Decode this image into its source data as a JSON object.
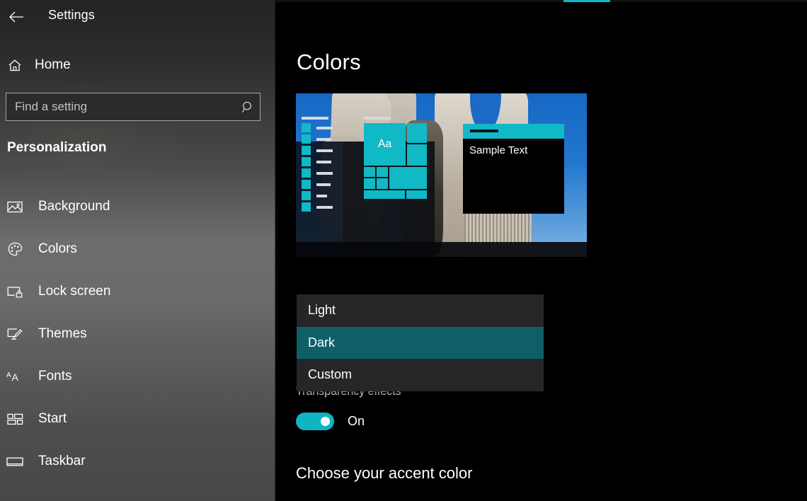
{
  "window": {
    "back_icon": "back-arrow-icon",
    "title": "Settings"
  },
  "sidebar": {
    "home": {
      "label": "Home",
      "icon": "home-icon"
    },
    "search": {
      "placeholder": "Find a setting",
      "value": "",
      "icon": "search-icon"
    },
    "section_title": "Personalization",
    "items": [
      {
        "label": "Background",
        "icon": "picture-icon"
      },
      {
        "label": "Colors",
        "icon": "palette-icon"
      },
      {
        "label": "Lock screen",
        "icon": "lock-screen-icon"
      },
      {
        "label": "Themes",
        "icon": "themes-brush-icon"
      },
      {
        "label": "Fonts",
        "icon": "fonts-icon"
      },
      {
        "label": "Start",
        "icon": "start-tiles-icon"
      },
      {
        "label": "Taskbar",
        "icon": "taskbar-icon"
      }
    ]
  },
  "main": {
    "page_title": "Colors",
    "preview": {
      "start_tile_text": "Aa",
      "sample_window_text": "Sample Text"
    },
    "theme_dropdown": {
      "options": [
        {
          "label": "Light",
          "selected": false
        },
        {
          "label": "Dark",
          "selected": true
        },
        {
          "label": "Custom",
          "selected": false
        }
      ]
    },
    "transparency": {
      "label": "Transparency effects",
      "toggle_state": "On",
      "toggle_on": true
    },
    "accent_heading": "Choose your accent color"
  },
  "colors": {
    "accent": "#11b8c6",
    "toggle_on": "#0fb4c3",
    "dropdown_selected": "#0e5f68",
    "dropdown_bg": "#262626",
    "main_bg": "#000000"
  }
}
